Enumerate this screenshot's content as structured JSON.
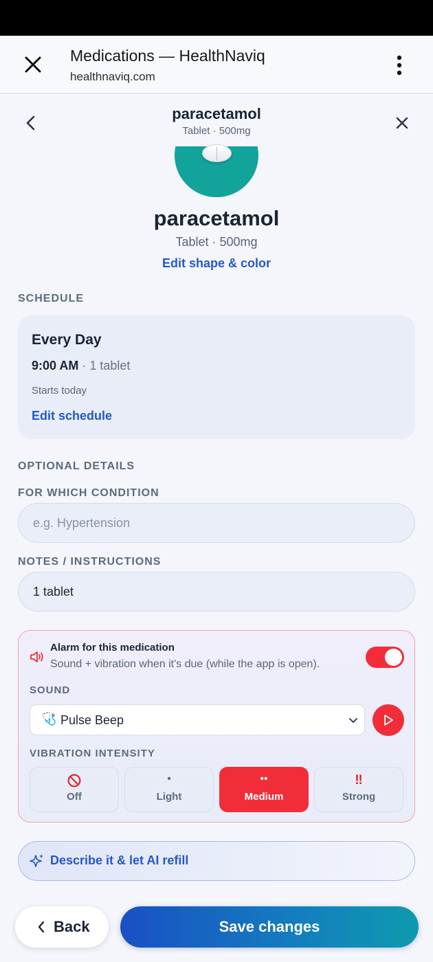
{
  "browser": {
    "title": "Medications — HealthNaviq",
    "url": "healthnaviq.com"
  },
  "header": {
    "name": "paracetamol",
    "subtitle": "Tablet · 500mg"
  },
  "medication": {
    "name": "paracetamol",
    "subtitle": "Tablet · 500mg",
    "edit_shape_label": "Edit shape & color",
    "pill_color": "#12a39a"
  },
  "schedule": {
    "section_label": "SCHEDULE",
    "frequency": "Every Day",
    "time": "9:00 AM",
    "dose": " · 1 tablet",
    "starts": "Starts today",
    "edit_label": "Edit schedule"
  },
  "optional": {
    "section_label": "OPTIONAL DETAILS",
    "condition_label": "FOR WHICH CONDITION",
    "condition_placeholder": "e.g. Hypertension",
    "condition_value": "",
    "notes_label": "NOTES / INSTRUCTIONS",
    "notes_value": "1 tablet"
  },
  "alarm": {
    "title": "Alarm for this medication",
    "description": "Sound + vibration when it's due (while the app is open).",
    "enabled": true,
    "sound_label": "SOUND",
    "sound_icon": "stethoscope-icon",
    "sound_value": "Pulse Beep",
    "vibration_label": "VIBRATION INTENSITY",
    "vibration_options": [
      {
        "label": "Off",
        "icon": "🚫"
      },
      {
        "label": "Light",
        "icon": "•"
      },
      {
        "label": "Medium",
        "icon": "••"
      },
      {
        "label": "Strong",
        "icon": "‼"
      }
    ],
    "vibration_selected": "Medium",
    "accent_color": "#f22d3a"
  },
  "ai": {
    "label": "Describe it & let AI refill"
  },
  "footer": {
    "back_label": "Back",
    "save_label": "Save changes"
  }
}
